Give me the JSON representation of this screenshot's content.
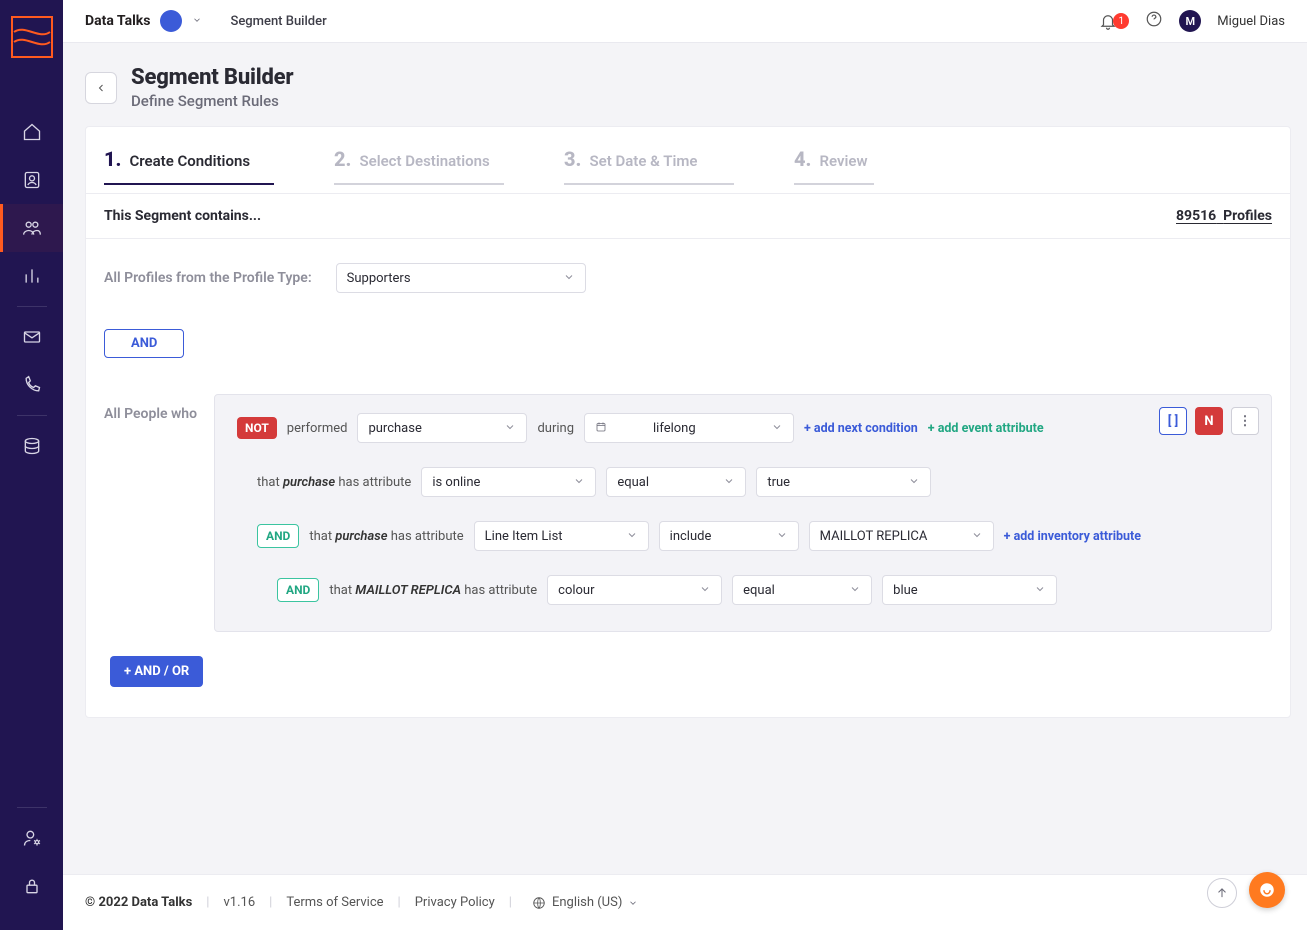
{
  "header": {
    "org_name": "Data Talks",
    "breadcrumb": "Segment Builder",
    "notif_count": "1",
    "avatar_letter": "M",
    "username": "Miguel Dias"
  },
  "page": {
    "title": "Segment Builder",
    "subtitle": "Define Segment Rules"
  },
  "steps": [
    {
      "num": "1.",
      "label": "Create Conditions",
      "active": true
    },
    {
      "num": "2.",
      "label": "Select Destinations",
      "active": false
    },
    {
      "num": "3.",
      "label": "Set Date & Time",
      "active": false
    },
    {
      "num": "4.",
      "label": "Review",
      "active": false
    }
  ],
  "segment_bar": {
    "label": "This Segment contains...",
    "count": "89516",
    "count_suffix": "Profiles"
  },
  "profile_type": {
    "label": "All Profiles from the Profile Type:",
    "value": "Supporters"
  },
  "logic": {
    "and": "AND",
    "people_label": "All People who",
    "add_and_or": "+ AND / OR"
  },
  "rule": {
    "not": "NOT",
    "performed": "performed",
    "event": "purchase",
    "during": "during",
    "timeframe": "lifelong",
    "add_next_condition": "+ add next condition",
    "add_event_attribute": "+ add event attribute",
    "line1": {
      "prefix": "that ",
      "event_italic": "purchase",
      "has_attribute": " has attribute",
      "attribute": "is online",
      "operator": "equal",
      "value": "true"
    },
    "line2": {
      "and": "AND",
      "prefix": "that ",
      "event_italic": "purchase",
      "has_attribute": " has attribute",
      "attribute": "Line Item List",
      "operator": "include",
      "value": "MAILLOT REPLICA",
      "add_inventory": "+ add inventory attribute"
    },
    "line3": {
      "and": "AND",
      "prefix": "that ",
      "item_italic": "MAILLOT REPLICA",
      "has_attribute": " has attribute",
      "attribute": "colour",
      "operator": "equal",
      "value": "blue"
    },
    "actions": {
      "brackets": "[ ]",
      "n": "N",
      "more": "⋮"
    }
  },
  "footer": {
    "copyright": "© 2022 Data Talks",
    "version": "v1.16",
    "tos": "Terms of Service",
    "privacy": "Privacy Policy",
    "lang": "English (US)"
  }
}
